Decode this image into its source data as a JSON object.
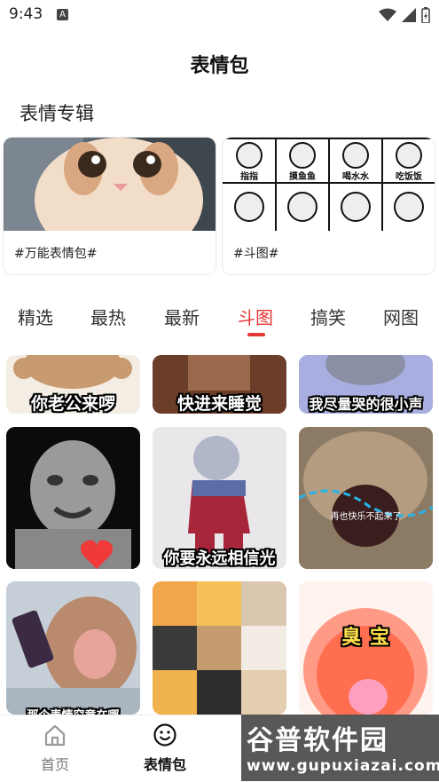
{
  "status": {
    "time": "9:43",
    "notif_icon": "a-icon"
  },
  "header": {
    "title": "表情包"
  },
  "albums_section": {
    "title": "表情专辑",
    "items": [
      {
        "label": "#万能表情包#"
      },
      {
        "label": "#斗图#",
        "tiles": [
          "指指",
          "摸鱼鱼",
          "喝水水",
          "吃饭饭"
        ]
      }
    ]
  },
  "tabs": [
    "精选",
    "最热",
    "最新",
    "斗图",
    "搞笑",
    "网图"
  ],
  "active_tab_index": 3,
  "grid": {
    "row1": [
      "你老公来啰",
      "快进来睡觉",
      "我尽量哭的很小声"
    ],
    "row2": [
      "",
      "你要永远相信光",
      "再也快乐不起来了"
    ],
    "row3": [
      "那个表情究竟在哪",
      "",
      "臭  宝"
    ]
  },
  "bottom_nav": [
    {
      "label": "首页",
      "icon": "home-icon"
    },
    {
      "label": "表情包",
      "icon": "smiley-icon"
    }
  ],
  "watermark": {
    "main": "谷普软件园",
    "sub": "www.gupuxiazai.com"
  },
  "colors": {
    "accent": "#e53935",
    "text": "#222222"
  }
}
